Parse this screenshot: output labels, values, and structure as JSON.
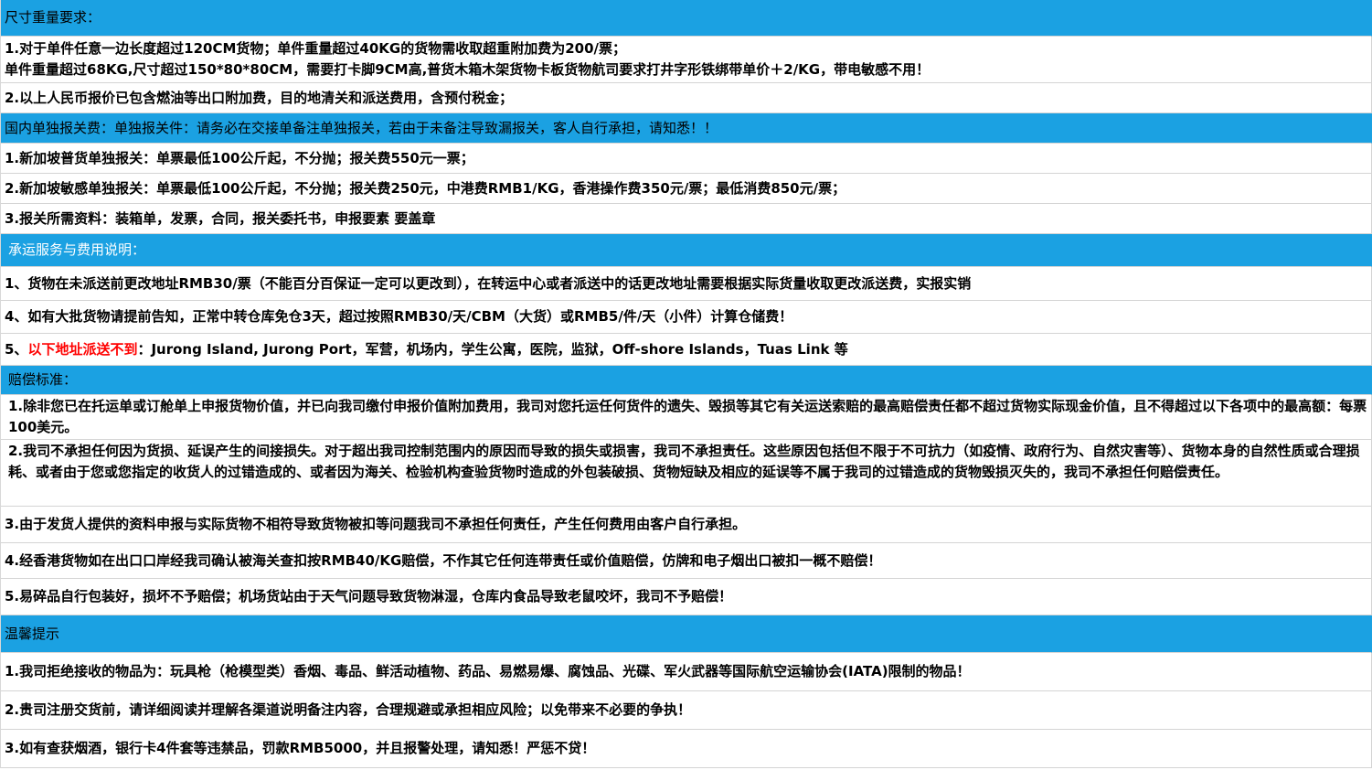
{
  "colors": {
    "header_bg": "#1ba1e2",
    "warning_text": "#ff0000"
  },
  "size_weight": {
    "title": "尺寸重量要求：",
    "line1a": "1.对于单件任意一边长度超过120CM货物；单件重量超过40KG的货物需收取超重附加费为200/票；",
    "line1b": "单件重量超过68KG,尺寸超过150*80*80CM，需要打卡脚9CM高,普货木箱木架货物卡板货物航司要求打井字形铁绑带单价＋2/KG，带电敏感不用！",
    "line2": "2.以上人民币报价已包含燃油等出口附加费，目的地清关和派送费用，含预付税金；"
  },
  "customs": {
    "title": "国内单独报关费：单独报关件：请务必在交接单备注单独报关，若由于未备注导致漏报关，客人自行承担，请知悉！！",
    "line1": "1.新加坡普货单独报关：单票最低100公斤起，不分抛；报关费550元一票；",
    "line2": "2.新加坡敏感单独报关：单票最低100公斤起，不分抛；报关费250元，中港费RMB1/KG，香港操作费350元/票；最低消费850元/票；",
    "line3": "3.报关所需资料：装箱单，发票，合同，报关委托书，申报要素   要盖章"
  },
  "service": {
    "title": "承运服务与费用说明：",
    "line1": "1、货物在未派送前更改地址RMB30/票（不能百分百保证一定可以更改到），在转运中心或者派送中的话更改地址需要根据实际货量收取更改派送费，实报实销",
    "line4": "4、如有大批货物请提前告知，正常中转仓库免仓3天，超过按照RMB30/天/CBM（大货）或RMB5/件/天（小件）计算仓储费！",
    "line5_prefix": "5、",
    "line5_red": "以下地址派送不到",
    "line5_rest": "：Jurong Island, Jurong Port，军营，机场内，学生公寓，医院，监狱，Off-shore Islands，Tuas Link  等"
  },
  "compensation": {
    "title": "赔偿标准：",
    "line1": "1.除非您已在托运单或订舱单上申报货物价值，并已向我司缴付申报价值附加费用，我司对您托运任何货件的遗失、毁损等其它有关运送索赔的最高赔偿责任都不超过货物实际现金价值，且不得超过以下各项中的最高额：每票100美元。",
    "line2": "2.我司不承担任何因为货损、延误产生的间接损失。对于超出我司控制范围内的原因而导致的损失或损害，我司不承担责任。这些原因包括但不限于不可抗力（如疫情、政府行为、自然灾害等）、货物本身的自然性质或合理损耗、或者由于您或您指定的收货人的过错造成的、或者因为海关、检验机构查验货物时造成的外包装破损、货物短缺及相应的延误等不属于我司的过错造成的货物毁损灭失的，我司不承担任何赔偿责任。",
    "line3": "3.由于发货人提供的资料申报与实际货物不相符导致货物被扣等问题我司不承担任何责任，产生任何费用由客户自行承担。",
    "line4": "4.经香港货物如在出口口岸经我司确认被海关查扣按RMB40/KG赔偿，不作其它任何连带责任或价值赔偿，仿牌和电子烟出口被扣一概不赔偿！",
    "line5": "5.易碎品自行包装好，损坏不予赔偿；机场货站由于天气问题导致货物淋湿，仓库内食品导致老鼠咬坏，我司不予赔偿！"
  },
  "tips": {
    "title": "温馨提示",
    "line1": "1.我司拒绝接收的物品为：玩具枪（枪模型类）香烟、毒品、鲜活动植物、药品、易燃易爆、腐蚀品、光碟、军火武器等国际航空运输协会(IATA)限制的物品！",
    "line2": "2.贵司注册交货前，请详细阅读并理解各渠道说明备注内容，合理规避或承担相应风险；以免带来不必要的争执！",
    "line3": "3.如有查获烟酒，银行卡4件套等违禁品，罚款RMB5000，并且报警处理，请知悉！严惩不贷！"
  }
}
